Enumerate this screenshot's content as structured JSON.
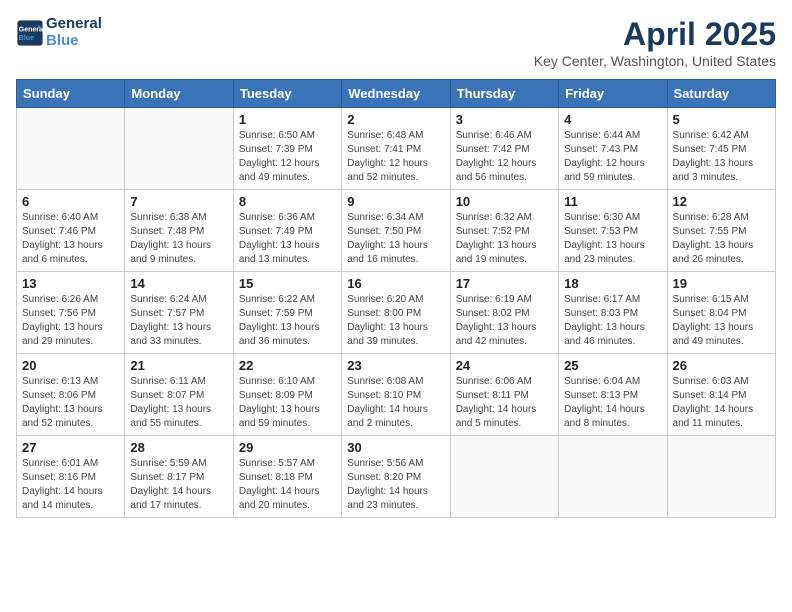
{
  "header": {
    "logo_line1": "General",
    "logo_line2": "Blue",
    "title": "April 2025",
    "subtitle": "Key Center, Washington, United States"
  },
  "days_of_week": [
    "Sunday",
    "Monday",
    "Tuesday",
    "Wednesday",
    "Thursday",
    "Friday",
    "Saturday"
  ],
  "weeks": [
    [
      {
        "day": "",
        "info": ""
      },
      {
        "day": "",
        "info": ""
      },
      {
        "day": "1",
        "info": "Sunrise: 6:50 AM\nSunset: 7:39 PM\nDaylight: 12 hours and 49 minutes."
      },
      {
        "day": "2",
        "info": "Sunrise: 6:48 AM\nSunset: 7:41 PM\nDaylight: 12 hours and 52 minutes."
      },
      {
        "day": "3",
        "info": "Sunrise: 6:46 AM\nSunset: 7:42 PM\nDaylight: 12 hours and 56 minutes."
      },
      {
        "day": "4",
        "info": "Sunrise: 6:44 AM\nSunset: 7:43 PM\nDaylight: 12 hours and 59 minutes."
      },
      {
        "day": "5",
        "info": "Sunrise: 6:42 AM\nSunset: 7:45 PM\nDaylight: 13 hours and 3 minutes."
      }
    ],
    [
      {
        "day": "6",
        "info": "Sunrise: 6:40 AM\nSunset: 7:46 PM\nDaylight: 13 hours and 6 minutes."
      },
      {
        "day": "7",
        "info": "Sunrise: 6:38 AM\nSunset: 7:48 PM\nDaylight: 13 hours and 9 minutes."
      },
      {
        "day": "8",
        "info": "Sunrise: 6:36 AM\nSunset: 7:49 PM\nDaylight: 13 hours and 13 minutes."
      },
      {
        "day": "9",
        "info": "Sunrise: 6:34 AM\nSunset: 7:50 PM\nDaylight: 13 hours and 16 minutes."
      },
      {
        "day": "10",
        "info": "Sunrise: 6:32 AM\nSunset: 7:52 PM\nDaylight: 13 hours and 19 minutes."
      },
      {
        "day": "11",
        "info": "Sunrise: 6:30 AM\nSunset: 7:53 PM\nDaylight: 13 hours and 23 minutes."
      },
      {
        "day": "12",
        "info": "Sunrise: 6:28 AM\nSunset: 7:55 PM\nDaylight: 13 hours and 26 minutes."
      }
    ],
    [
      {
        "day": "13",
        "info": "Sunrise: 6:26 AM\nSunset: 7:56 PM\nDaylight: 13 hours and 29 minutes."
      },
      {
        "day": "14",
        "info": "Sunrise: 6:24 AM\nSunset: 7:57 PM\nDaylight: 13 hours and 33 minutes."
      },
      {
        "day": "15",
        "info": "Sunrise: 6:22 AM\nSunset: 7:59 PM\nDaylight: 13 hours and 36 minutes."
      },
      {
        "day": "16",
        "info": "Sunrise: 6:20 AM\nSunset: 8:00 PM\nDaylight: 13 hours and 39 minutes."
      },
      {
        "day": "17",
        "info": "Sunrise: 6:19 AM\nSunset: 8:02 PM\nDaylight: 13 hours and 42 minutes."
      },
      {
        "day": "18",
        "info": "Sunrise: 6:17 AM\nSunset: 8:03 PM\nDaylight: 13 hours and 46 minutes."
      },
      {
        "day": "19",
        "info": "Sunrise: 6:15 AM\nSunset: 8:04 PM\nDaylight: 13 hours and 49 minutes."
      }
    ],
    [
      {
        "day": "20",
        "info": "Sunrise: 6:13 AM\nSunset: 8:06 PM\nDaylight: 13 hours and 52 minutes."
      },
      {
        "day": "21",
        "info": "Sunrise: 6:11 AM\nSunset: 8:07 PM\nDaylight: 13 hours and 55 minutes."
      },
      {
        "day": "22",
        "info": "Sunrise: 6:10 AM\nSunset: 8:09 PM\nDaylight: 13 hours and 59 minutes."
      },
      {
        "day": "23",
        "info": "Sunrise: 6:08 AM\nSunset: 8:10 PM\nDaylight: 14 hours and 2 minutes."
      },
      {
        "day": "24",
        "info": "Sunrise: 6:06 AM\nSunset: 8:11 PM\nDaylight: 14 hours and 5 minutes."
      },
      {
        "day": "25",
        "info": "Sunrise: 6:04 AM\nSunset: 8:13 PM\nDaylight: 14 hours and 8 minutes."
      },
      {
        "day": "26",
        "info": "Sunrise: 6:03 AM\nSunset: 8:14 PM\nDaylight: 14 hours and 11 minutes."
      }
    ],
    [
      {
        "day": "27",
        "info": "Sunrise: 6:01 AM\nSunset: 8:16 PM\nDaylight: 14 hours and 14 minutes."
      },
      {
        "day": "28",
        "info": "Sunrise: 5:59 AM\nSunset: 8:17 PM\nDaylight: 14 hours and 17 minutes."
      },
      {
        "day": "29",
        "info": "Sunrise: 5:57 AM\nSunset: 8:18 PM\nDaylight: 14 hours and 20 minutes."
      },
      {
        "day": "30",
        "info": "Sunrise: 5:56 AM\nSunset: 8:20 PM\nDaylight: 14 hours and 23 minutes."
      },
      {
        "day": "",
        "info": ""
      },
      {
        "day": "",
        "info": ""
      },
      {
        "day": "",
        "info": ""
      }
    ]
  ]
}
